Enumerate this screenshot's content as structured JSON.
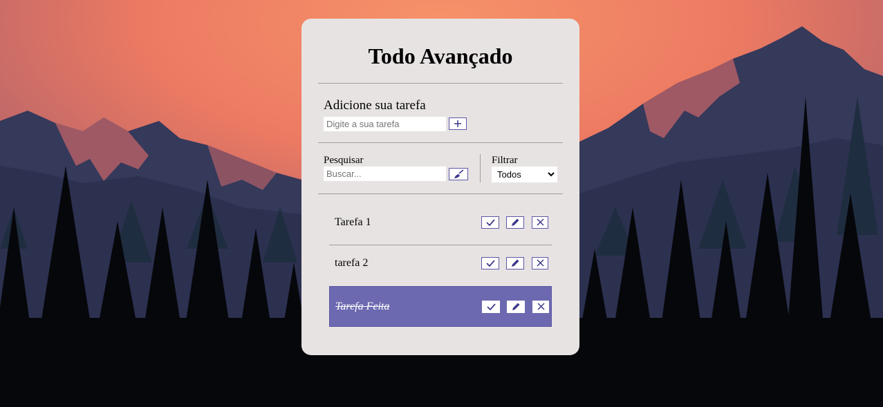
{
  "app": {
    "title": "Todo Avançado"
  },
  "add": {
    "label": "Adicione sua tarefa",
    "input_placeholder": "Digite a sua tarefa",
    "input_value": "",
    "button_icon": "plus-icon"
  },
  "search": {
    "label": "Pesquisar",
    "input_placeholder": "Buscar...",
    "input_value": "",
    "button_icon": "eraser-icon"
  },
  "filter": {
    "label": "Filtrar",
    "selected": "Todos"
  },
  "todos": [
    {
      "text": "Tarefa 1",
      "done": false
    },
    {
      "text": "tarefa 2",
      "done": false
    },
    {
      "text": "Tarefa Feita",
      "done": true
    }
  ],
  "colors": {
    "card_background": "#e8e3e3",
    "accent": "#5c56a6",
    "done_background": "#6c69b0"
  }
}
